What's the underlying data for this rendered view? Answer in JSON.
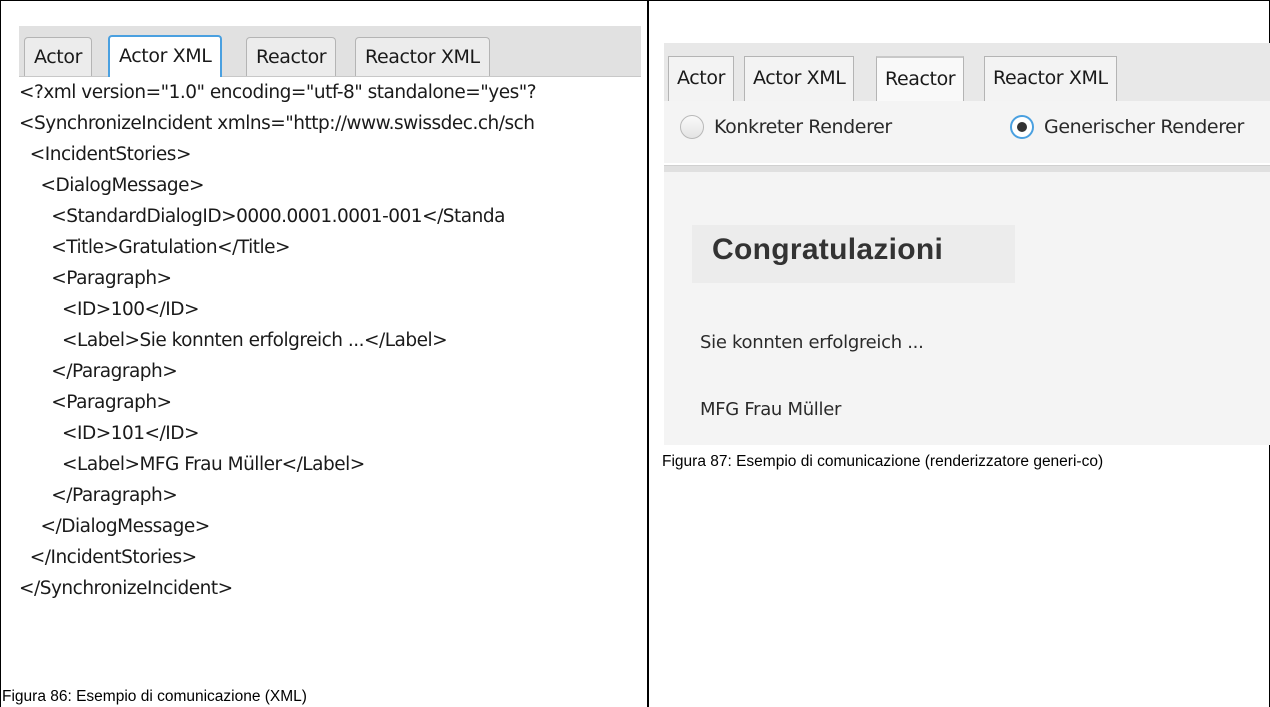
{
  "left_figure": {
    "tabs": [
      {
        "label": "Actor",
        "active": false
      },
      {
        "label": "Actor XML",
        "active": true
      },
      {
        "label": "Reactor",
        "active": false
      },
      {
        "label": "Reactor XML",
        "active": false
      }
    ],
    "xml_lines": [
      "<?xml version=\"1.0\" encoding=\"utf-8\" standalone=\"yes\"?",
      "<SynchronizeIncident xmlns=\"http://www.swissdec.ch/sch",
      "  <IncidentStories>",
      "    <DialogMessage>",
      "      <StandardDialogID>0000.0001.0001-001</Standa",
      "      <Title>Gratulation</Title>",
      "      <Paragraph>",
      "        <ID>100</ID>",
      "        <Label>Sie konnten erfolgreich ...</Label>",
      "      </Paragraph>",
      "      <Paragraph>",
      "        <ID>101</ID>",
      "        <Label>MFG Frau Müller</Label>",
      "      </Paragraph>",
      "    </DialogMessage>",
      "  </IncidentStories>",
      "</SynchronizeIncident>"
    ],
    "caption": "Figura 86: Esempio di comunicazione (XML)"
  },
  "right_figure": {
    "tabs": [
      {
        "label": "Actor",
        "active": false
      },
      {
        "label": "Actor XML",
        "active": false
      },
      {
        "label": "Reactor",
        "active": true
      },
      {
        "label": "Reactor XML",
        "active": false
      }
    ],
    "radios": [
      {
        "label": "Konkreter Renderer",
        "checked": false
      },
      {
        "label": "Generischer Renderer",
        "checked": true
      }
    ],
    "title": "Congratulazioni",
    "paragraphs": [
      "Sie konnten erfolgreich ...",
      "MFG Frau Müller"
    ],
    "caption": "Figura 87: Esempio di comunicazione (renderizzatore generi-co)"
  },
  "colors": {
    "tab_focus": "#4aa0e0",
    "tab_bar": "#e1e1e1",
    "panel_bg": "#f4f4f4"
  }
}
